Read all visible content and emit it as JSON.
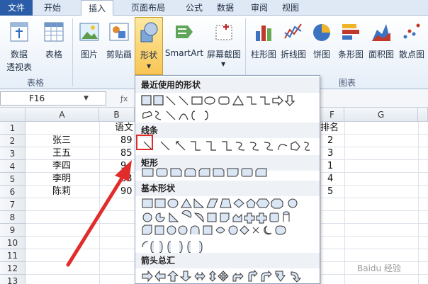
{
  "tabs": [
    "文件",
    "开始",
    "插入",
    "页面布局",
    "公式",
    "数据",
    "审阅",
    "视图"
  ],
  "ribbon": {
    "pivot_label": "数据",
    "pivot_label2": "透视表",
    "table_label": "表格",
    "picture_label": "图片",
    "clipart_label": "剪贴画",
    "shapes_label": "形状",
    "smartart_label": "SmartArt",
    "screenshot_label": "屏幕截图",
    "column_label": "柱形图",
    "line_label": "折线图",
    "pie_label": "饼图",
    "bar_label": "条形图",
    "area_label": "面积图",
    "scatter_label": "散点图",
    "group_tables": "表格",
    "group_charts": "图表",
    "accent": "#f8c554"
  },
  "namebox": {
    "value": "F16"
  },
  "columns": [
    "A",
    "B",
    "F",
    "G"
  ],
  "rows": [
    "1",
    "2",
    "3",
    "4",
    "5",
    "6",
    "7",
    "8",
    "9",
    "10",
    "11",
    "12",
    "13"
  ],
  "cells": {
    "b1": "语文",
    "f1": "排名",
    "names": [
      "张三",
      "王五",
      "李四",
      "李明",
      "陈莉"
    ],
    "b_values": [
      "89",
      "85",
      "9",
      "83",
      "90"
    ],
    "ranks": [
      "2",
      "3",
      "1",
      "4",
      "5"
    ]
  },
  "dropdown": {
    "recent": "最近使用的形状",
    "lines": "线条",
    "rect": "矩形",
    "basic": "基本形状",
    "arrows": "箭头总汇"
  },
  "watermark": "Baidu 经验"
}
